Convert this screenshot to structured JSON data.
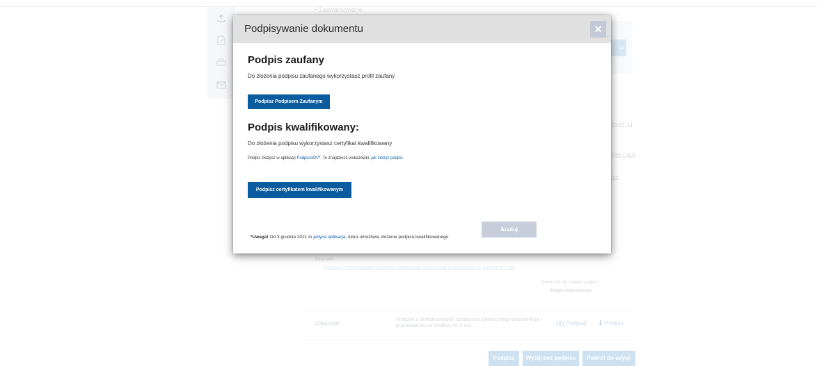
{
  "background": {
    "status_item": "Zaawansowane",
    "right_button_fragment": "su",
    "edge_texts": [
      "23-01-11",
      "ODLCADI",
      "/21"
    ],
    "attachments_heading": "Załączniki:",
    "attachment_link": "Wniosek o dofinansowanie kształcenia ustawicznego pracowników i pracodawców ze środków KFS.doc",
    "signature_status": "Dokument nie zawiera podpisu",
    "signature_type": "Podpis elektroniczny",
    "attachments_row": {
      "label": "Załączniki",
      "file_name": "Wniosek o dofinansowanie kształcenia ustawicznego pracowników i pracodawców ze środków KFS.doc",
      "preview_label": "Podgląd",
      "download_label": "Pobierz"
    },
    "bottom_buttons": {
      "sign": "Podpisz",
      "send_unsigned": "Wyślij bez podpisu",
      "back_to_edit": "Powrót do edycji"
    }
  },
  "dialog": {
    "title": "Podpisywanie dokumentu",
    "close_glyph": "×",
    "trusted": {
      "title": "Podpis zaufany",
      "description": "Do złożenia podpisu zaufanego wykorzystasz profil zaufany",
      "button": "Podpisz Podpisem Zaufanym"
    },
    "qualified": {
      "title": "Podpis kwalifikowany:",
      "description": "Do złożenia podpisu wykorzystasz certyfikat kwalifikowany",
      "hint_prefix": "Podpis złożysz w aplikacji ",
      "hint_app": "PodpisGOV",
      "hint_middle": "*. To znajdziesz wskazówki, ",
      "hint_link": "jak złożyć podpis",
      "hint_suffix": ".",
      "button": "Podpisz certyfikatem kwalifikowanym"
    },
    "note": {
      "bold": "*Uwaga!",
      "text_before": " Od 3 grudnia 2021 to ",
      "link": "jedyna aplikacja",
      "text_after": ", która umożliwia złożenie podpisu kwalifikowanego."
    },
    "cancel": "Anuluj"
  },
  "colors": {
    "primary": "#0b5c9e",
    "link": "#0f5ca8",
    "header_bg": "#e0e0e0",
    "close_bg": "#c3c9d6",
    "cancel_bg": "#c7cdd9"
  },
  "icons": [
    "upload-icon",
    "edit-icon",
    "print-icon",
    "mail-icon",
    "close-icon",
    "eye-icon",
    "download-icon"
  ]
}
